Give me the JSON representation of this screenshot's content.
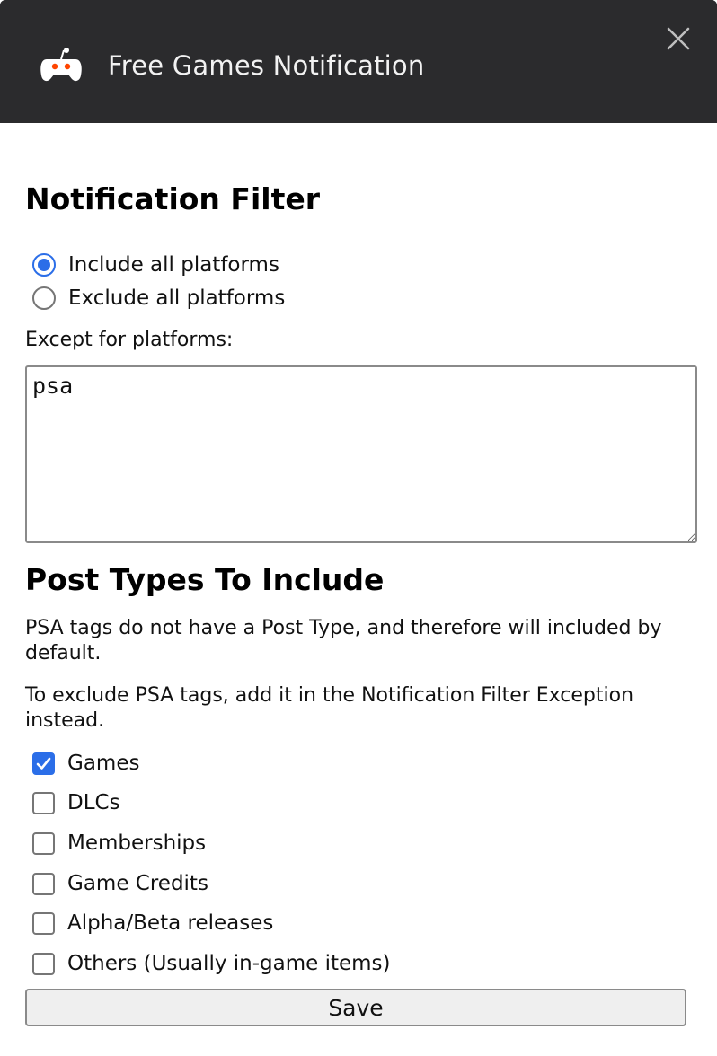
{
  "header": {
    "title": "Free Games Notification",
    "logo_icon": "reddit-gamepad-icon",
    "close_icon": "close-icon"
  },
  "filter": {
    "heading": "Notification Filter",
    "options": [
      {
        "label": "Include all platforms",
        "checked": true
      },
      {
        "label": "Exclude all platforms",
        "checked": false
      }
    ],
    "except_label": "Except for platforms:",
    "except_value": "psa"
  },
  "post_types": {
    "heading": "Post Types To Include",
    "note1": "PSA tags do not have a Post Type, and therefore will included by default.",
    "note2": "To exclude PSA tags, add it in the Notification Filter Exception instead.",
    "items": [
      {
        "label": "Games",
        "checked": true
      },
      {
        "label": "DLCs",
        "checked": false
      },
      {
        "label": "Memberships",
        "checked": false
      },
      {
        "label": "Game Credits",
        "checked": false
      },
      {
        "label": "Alpha/Beta releases",
        "checked": false
      },
      {
        "label": "Others (Usually in-game items)",
        "checked": false
      }
    ]
  },
  "save_label": "Save",
  "colors": {
    "header_bg": "#2b2b2d",
    "accent": "#2b6ee8",
    "logo_orange": "#ff4500"
  }
}
